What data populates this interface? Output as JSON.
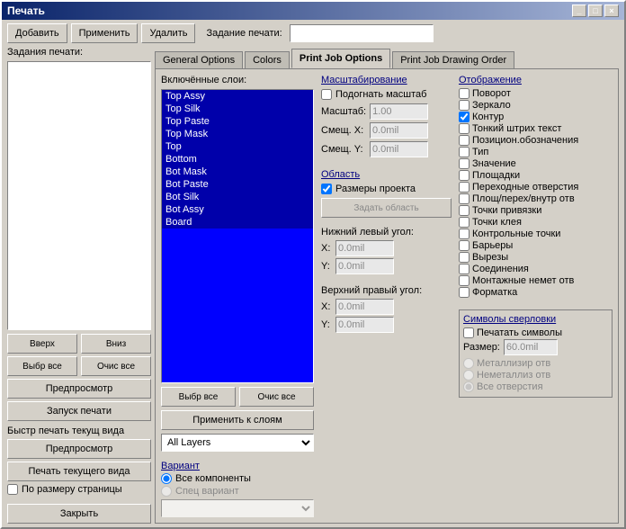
{
  "window": {
    "title": "Печать"
  },
  "toolbar": {
    "add_label": "Добавить",
    "apply_label": "Применить",
    "delete_label": "Удалить",
    "job_label": "Задание печати:"
  },
  "left_panel": {
    "jobs_label": "Задания печати:",
    "up_label": "Вверх",
    "down_label": "Вниз",
    "select_all_label": "Выбр все",
    "clear_all_label": "Очис все",
    "preview_label": "Предпросмотр",
    "run_print_label": "Запуск печати",
    "quick_print_label": "Быстр печать  текущ вида",
    "preview2_label": "Предпросмотр",
    "print_current_label": "Печать текущего вида",
    "fit_page_label": "По размеру страницы",
    "close_label": "Закрыть"
  },
  "tabs": {
    "items": [
      {
        "label": "General Options",
        "active": false
      },
      {
        "label": "Colors",
        "active": false
      },
      {
        "label": "Print Job Options",
        "active": true
      },
      {
        "label": "Print Job Drawing Order",
        "active": false
      }
    ]
  },
  "layers": {
    "label": "Включённые слои:",
    "items": [
      "Top Assy",
      "Top Silk",
      "Top Paste",
      "Top Mask",
      "Top",
      "Bottom",
      "Bot Mask",
      "Bot Paste",
      "Bot Silk",
      "Bot Assy",
      "Board"
    ],
    "select_all_label": "Выбр все",
    "clear_all_label": "Очис все",
    "apply_label": "Применить к слоям",
    "all_layers_label": "All Layers"
  },
  "scaling": {
    "label": "Масштабирование",
    "fit_label": "Подогнать масштаб",
    "scale_label": "Масштаб:",
    "scale_value": "1.00",
    "offset_x_label": "Смещ. X:",
    "offset_x_value": "0.0mil",
    "offset_y_label": "Смещ. Y:",
    "offset_y_value": "0.0mil"
  },
  "area": {
    "label": "Область",
    "project_size_label": "Размеры проекта",
    "set_area_label": "Задать область",
    "lower_left_label": "Нижний левый угол:",
    "x_label": "X:",
    "x_value": "0.0mil",
    "y_label": "Y:",
    "y_value": "0.0mil",
    "upper_right_label": "Верхний правый угол:",
    "x2_label": "X:",
    "x2_value": "0.0mil",
    "y2_label": "Y:",
    "y2_value": "0.0mil"
  },
  "variant": {
    "label": "Вариант",
    "all_components_label": "Все компоненты",
    "special_label": "Спец вариант"
  },
  "display": {
    "label": "Отображение",
    "items": [
      {
        "label": "Поворот",
        "checked": false
      },
      {
        "label": "Зеркало",
        "checked": false
      },
      {
        "label": "Контур",
        "checked": true
      },
      {
        "label": "Тонкий штрих текст",
        "checked": false
      },
      {
        "label": "Позицион.обозначения",
        "checked": false
      },
      {
        "label": "Тип",
        "checked": false
      },
      {
        "label": "Значение",
        "checked": false
      },
      {
        "label": "Площадки",
        "checked": false
      },
      {
        "label": "Переходные отверстия",
        "checked": false
      },
      {
        "label": "Площ/перех/внутр отв",
        "checked": false
      },
      {
        "label": "Точки привязки",
        "checked": false
      },
      {
        "label": "Точки клея",
        "checked": false
      },
      {
        "label": "Контрольные точки",
        "checked": false
      },
      {
        "label": "Барьеры",
        "checked": false
      },
      {
        "label": "Вырезы",
        "checked": false
      },
      {
        "label": "Соединения",
        "checked": false
      },
      {
        "label": "Монтажные немет отв",
        "checked": false
      },
      {
        "label": "Форматка",
        "checked": false
      }
    ]
  },
  "drill": {
    "label": "Символы сверловки",
    "print_label": "Печатать символы",
    "size_label": "Размер:",
    "size_value": "60.0mil",
    "metal_label": "Металлизир отв",
    "nonmetal_label": "Неметаллиз отв",
    "all_label": "Все отверстия",
    "print_checked": false,
    "metal_checked": false,
    "nonmetal_checked": false,
    "all_checked": true
  }
}
